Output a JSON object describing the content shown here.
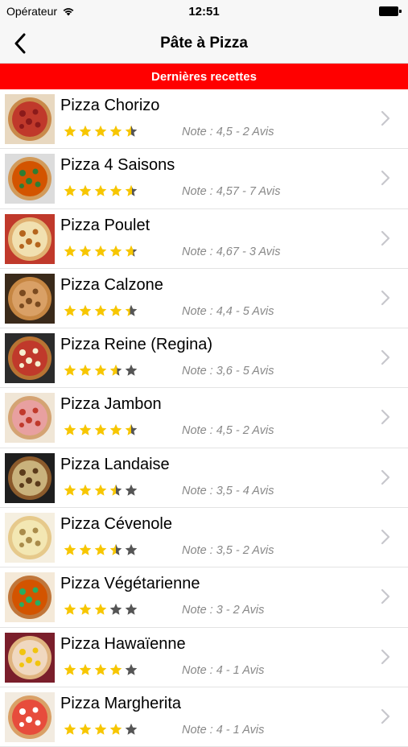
{
  "status_bar": {
    "carrier": "Opérateur",
    "time": "12:51"
  },
  "nav": {
    "title": "Pâte à Pizza"
  },
  "section": {
    "title": "Dernières recettes"
  },
  "colors": {
    "accent_red": "#ff0000",
    "star_gold": "#f7c600",
    "star_empty": "#555555"
  },
  "icons": {
    "back": "chevron-left-icon",
    "row_arrow": "chevron-right-icon",
    "star": "star-icon",
    "wifi": "wifi-icon",
    "battery": "battery-icon"
  },
  "recipes": [
    {
      "title": "Pizza Chorizo",
      "note": "Note : 4,5 - 2 Avis",
      "rating": 4.5
    },
    {
      "title": "Pizza 4 Saisons",
      "note": "Note : 4,57 - 7 Avis",
      "rating": 4.57
    },
    {
      "title": "Pizza Poulet",
      "note": "Note : 4,67 - 3 Avis",
      "rating": 4.67
    },
    {
      "title": "Pizza Calzone",
      "note": "Note : 4,4 - 5 Avis",
      "rating": 4.4
    },
    {
      "title": "Pizza Reine (Regina)",
      "note": "Note : 3,6 - 5 Avis",
      "rating": 3.6
    },
    {
      "title": "Pizza Jambon",
      "note": "Note : 4,5 - 2 Avis",
      "rating": 4.5
    },
    {
      "title": "Pizza Landaise",
      "note": "Note : 3,5 - 4 Avis",
      "rating": 3.5
    },
    {
      "title": "Pizza Cévenole",
      "note": "Note : 3,5 - 2 Avis",
      "rating": 3.5
    },
    {
      "title": "Pizza Végétarienne",
      "note": "Note : 3 - 2 Avis",
      "rating": 3
    },
    {
      "title": "Pizza Hawaïenne",
      "note": "Note : 4 - 1 Avis",
      "rating": 4
    },
    {
      "title": "Pizza Margherita",
      "note": "Note : 4 - 1 Avis",
      "rating": 4
    }
  ]
}
